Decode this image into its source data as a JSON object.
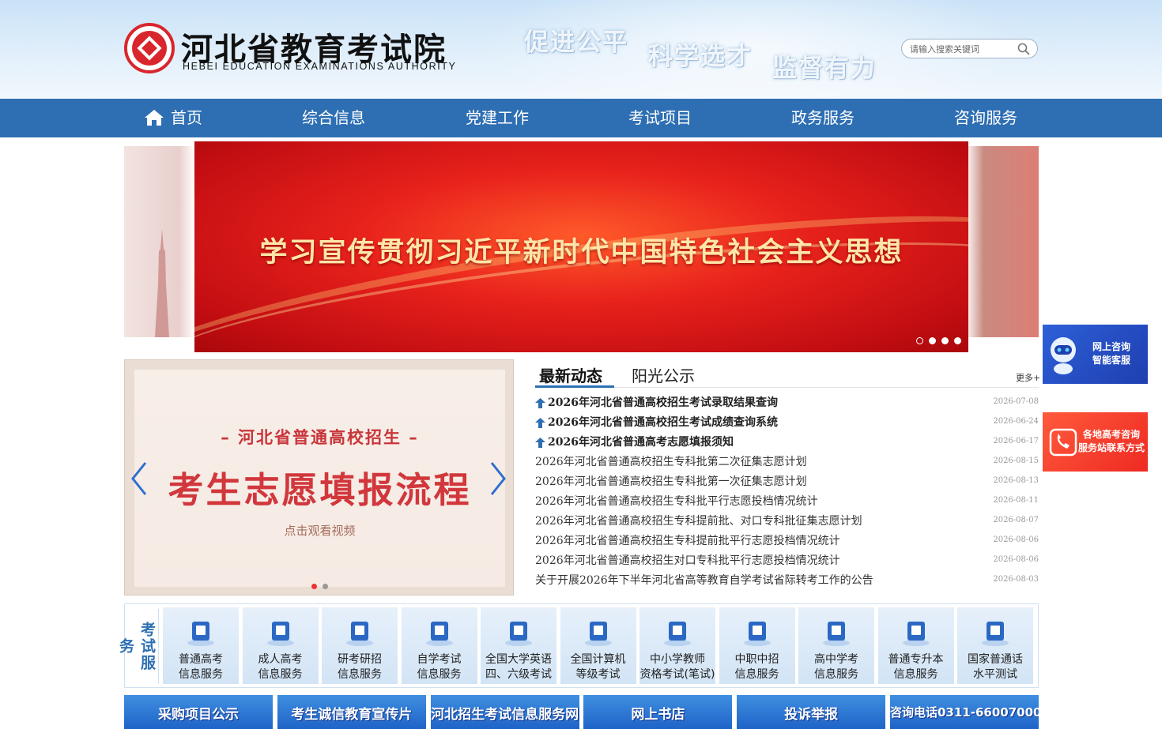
{
  "header": {
    "title_cn": "河北省教育考试院",
    "title_en": "HEBEI EDUCATION EXAMINATIONS AUTHORITY",
    "slogans": [
      "促进公平",
      "科学选才",
      "监督有力"
    ],
    "search_placeholder": "请输入搜索关键词",
    "emblem_icon": "hebei-education-emblem-icon",
    "search_icon": "magnifier-icon"
  },
  "nav": {
    "items": [
      "首页",
      "综合信息",
      "党建工作",
      "考试项目",
      "政务服务",
      "咨询服务"
    ],
    "home_icon": "home-icon",
    "bg_color": "#2e6fb3"
  },
  "banner": {
    "title": "学习宣传贯彻习近平新时代中国特色社会主义思想",
    "slide_count": 4,
    "active_slide": 1
  },
  "video_panel": {
    "subtitle": "– 河北省普通高校招生 –",
    "title": "考生志愿填报流程",
    "hint": "点击观看视频",
    "slide_count": 2,
    "active_slide": 1
  },
  "news": {
    "tabs": [
      "最新动态",
      "阳光公示"
    ],
    "active_tab": 0,
    "more_label": "更多+",
    "items": [
      {
        "title": "2026年河北省普通高校招生考试录取结果查询",
        "date": "2026-07-08",
        "pinned": true
      },
      {
        "title": "2026年河北省普通高校招生考试成绩查询系统",
        "date": "2026-06-24",
        "pinned": true
      },
      {
        "title": "2026年河北省普通高考志愿填报须知",
        "date": "2026-06-17",
        "pinned": true
      },
      {
        "title": "2026年河北省普通高校招生专科批第二次征集志愿计划",
        "date": "2026-08-15",
        "pinned": false
      },
      {
        "title": "2026年河北省普通高校招生专科批第一次征集志愿计划",
        "date": "2026-08-13",
        "pinned": false
      },
      {
        "title": "2026年河北省普通高校招生专科批平行志愿投档情况统计",
        "date": "2026-08-11",
        "pinned": false
      },
      {
        "title": "2026年河北省普通高校招生专科提前批、对口专科批征集志愿计划",
        "date": "2026-08-07",
        "pinned": false
      },
      {
        "title": "2026年河北省普通高校招生专科提前批平行志愿投档情况统计",
        "date": "2026-08-06",
        "pinned": false
      },
      {
        "title": "2026年河北省普通高校招生对口专科批平行志愿投档情况统计",
        "date": "2026-08-06",
        "pinned": false
      },
      {
        "title": "关于开展2026年下半年河北省高等教育自学考试省际转考工作的公告",
        "date": "2026-08-03",
        "pinned": false
      }
    ]
  },
  "services": {
    "label": "考试服务",
    "items": [
      {
        "line1": "普通高考",
        "line2": "信息服务",
        "icon": "book-icon"
      },
      {
        "line1": "成人高考",
        "line2": "信息服务",
        "icon": "notebook-icon"
      },
      {
        "line1": "研考研招",
        "line2": "信息服务",
        "icon": "folder-icon"
      },
      {
        "line1": "自学考试",
        "line2": "信息服务",
        "icon": "reader-icon"
      },
      {
        "line1": "全国大学英语",
        "line2": "四、六级考试",
        "icon": "letter-a-icon"
      },
      {
        "line1": "全国计算机",
        "line2": "等级考试",
        "icon": "keyboard-icon"
      },
      {
        "line1": "中小学教师",
        "line2": "资格考试(笔试)",
        "icon": "books-stack-icon"
      },
      {
        "line1": "中职中招",
        "line2": "信息服务",
        "icon": "teacher-board-icon"
      },
      {
        "line1": "高中学考",
        "line2": "信息服务",
        "icon": "document-search-icon"
      },
      {
        "line1": "普通专升本",
        "line2": "信息服务",
        "icon": "open-book-icon"
      },
      {
        "line1": "国家普通话",
        "line2": "水平测试",
        "icon": "sound-wave-icon"
      }
    ]
  },
  "bottom_links": [
    "采购项目公示",
    "考生诚信教育宣传片",
    "河北招生考试信息服务网",
    "网上书店",
    "投诉举报",
    "咨询电话0311-66007000"
  ],
  "floating": {
    "ai_line1": "网上咨询",
    "ai_line2": "智能客服",
    "ai_icon": "robot-assistant-icon",
    "phone_line1": "各地高考咨询",
    "phone_line2": "服务站联系方式",
    "phone_icon": "phone-icon"
  },
  "colors": {
    "accent_blue": "#2e6fb3",
    "emblem_red": "#d9262c",
    "banner_red": "#e8221c",
    "title_red": "#d1373c"
  }
}
